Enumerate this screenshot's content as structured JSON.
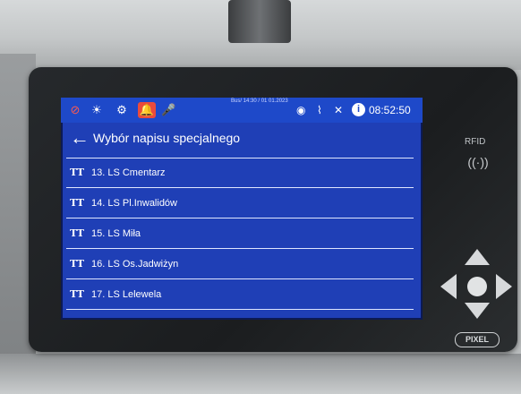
{
  "statusbar": {
    "small_text": "Bus/ 14:30 / 01 01.2023",
    "clock": "08:52:50",
    "icons": [
      "fault-icon",
      "brightness-icon",
      "gear-icon",
      "bell-icon",
      "mic-icon",
      "location-icon",
      "rss-icon",
      "signal-icon",
      "info-icon"
    ]
  },
  "header": {
    "back_symbol": "←",
    "title": "Wybór napisu specjalnego"
  },
  "list": {
    "items": [
      {
        "icon": "TT",
        "label": "13. LS Cmentarz"
      },
      {
        "icon": "TT",
        "label": "14. LS Pl.Inwalidów"
      },
      {
        "icon": "TT",
        "label": "15. LS Miła"
      },
      {
        "icon": "TT",
        "label": "16. LS Os.Jadwiżyn"
      },
      {
        "icon": "TT",
        "label": "17. LS Lelewela"
      }
    ]
  },
  "device": {
    "rfid_label": "RFID",
    "brand": "PIXEL"
  },
  "colors": {
    "screen_bg": "#1f3fb6",
    "statusbar_bg": "#1e49c9",
    "alert_red": "#ea4b3c",
    "bezel": "#1b1d1f"
  }
}
